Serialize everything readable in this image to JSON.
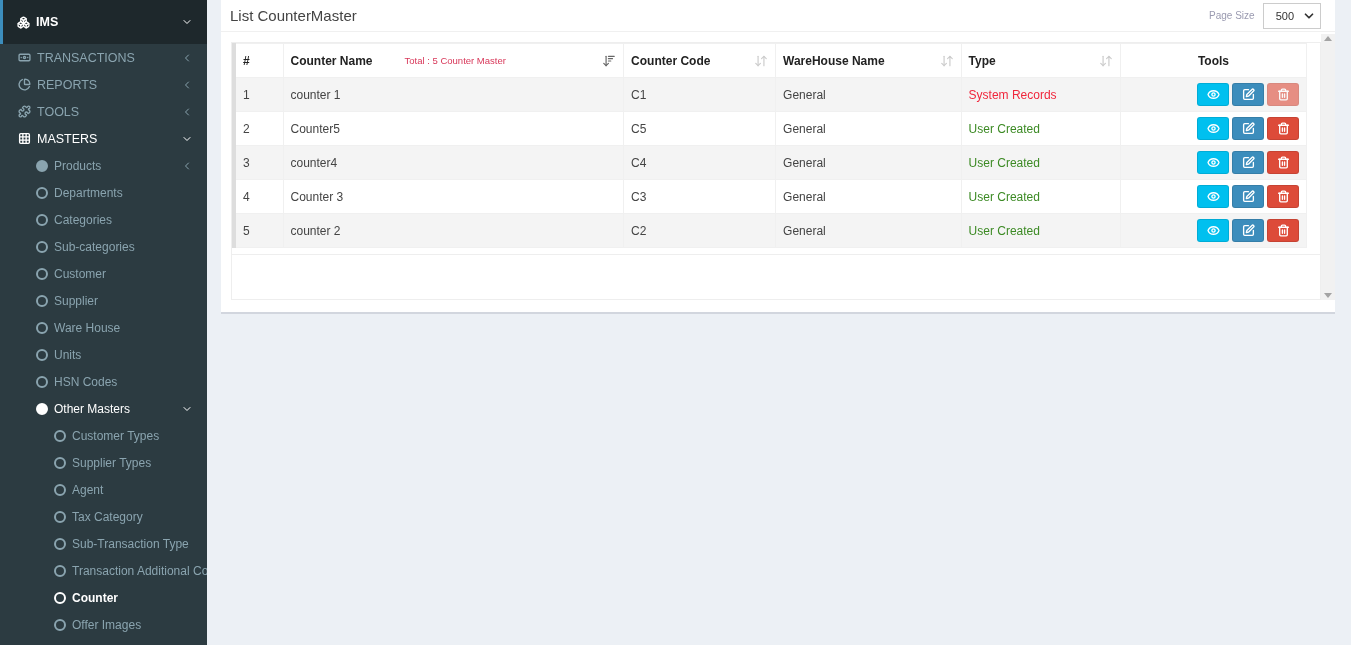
{
  "sidebar": {
    "items": [
      {
        "label": "IMS",
        "expanded": true,
        "kind": "header"
      },
      {
        "label": "TRANSACTIONS",
        "expanded": false,
        "kind": "section"
      },
      {
        "label": "REPORTS",
        "expanded": false,
        "kind": "section"
      },
      {
        "label": "TOOLS",
        "expanded": false,
        "kind": "section"
      },
      {
        "label": "MASTERS",
        "expanded": true,
        "kind": "section",
        "children": [
          {
            "label": "Products",
            "expanded": false,
            "selected": false,
            "kind": "group"
          },
          {
            "label": "Departments",
            "selected": false
          },
          {
            "label": "Categories",
            "selected": false
          },
          {
            "label": "Sub-categories",
            "selected": false
          },
          {
            "label": "Customer",
            "selected": false
          },
          {
            "label": "Supplier",
            "selected": false
          },
          {
            "label": "Ware House",
            "selected": false
          },
          {
            "label": "Units",
            "selected": false
          },
          {
            "label": "HSN Codes",
            "selected": false
          },
          {
            "label": "Other Masters",
            "expanded": true,
            "selected": false,
            "kind": "group",
            "children": [
              {
                "label": "Customer Types",
                "selected": false
              },
              {
                "label": "Supplier Types",
                "selected": false
              },
              {
                "label": "Agent",
                "selected": false
              },
              {
                "label": "Tax Category",
                "selected": false
              },
              {
                "label": "Sub-Transaction Type",
                "selected": false
              },
              {
                "label": "Transaction Additional Co",
                "selected": false
              },
              {
                "label": "Counter",
                "selected": true
              },
              {
                "label": "Offer Images",
                "selected": false
              }
            ]
          }
        ]
      }
    ]
  },
  "card": {
    "title": "List CounterMaster",
    "page_size_label": "Page Size",
    "page_size": "500"
  },
  "table": {
    "total": "Total : 5 Counter Master",
    "columns": [
      {
        "label": "#",
        "kind": "plain"
      },
      {
        "label": "Counter Name",
        "kind": "sortable",
        "sorted": true
      },
      {
        "label": "Counter Code",
        "kind": "sortable",
        "sorted": false
      },
      {
        "label": "WareHouse Name",
        "kind": "sortable",
        "sorted": false
      },
      {
        "label": "Type",
        "kind": "sortable",
        "sorted": false
      },
      {
        "label": "Tools",
        "kind": "plain"
      }
    ],
    "rows": [
      {
        "no": "1",
        "name": "counter 1",
        "code": "C1",
        "warehouse": "General",
        "type": "System Records",
        "kind": "system",
        "delete_disabled": true
      },
      {
        "no": "2",
        "name": "Counter5",
        "code": "C5",
        "warehouse": "General",
        "type": "User Created",
        "kind": "user",
        "delete_disabled": false
      },
      {
        "no": "3",
        "name": "counter4",
        "code": "C4",
        "warehouse": "General",
        "type": "User Created",
        "kind": "user",
        "delete_disabled": false
      },
      {
        "no": "4",
        "name": "Counter 3",
        "code": "C3",
        "warehouse": "General",
        "type": "User Created",
        "kind": "user",
        "delete_disabled": false
      },
      {
        "no": "5",
        "name": "counter 2",
        "code": "C2",
        "warehouse": "General",
        "type": "User Created",
        "kind": "user",
        "delete_disabled": false
      }
    ]
  }
}
